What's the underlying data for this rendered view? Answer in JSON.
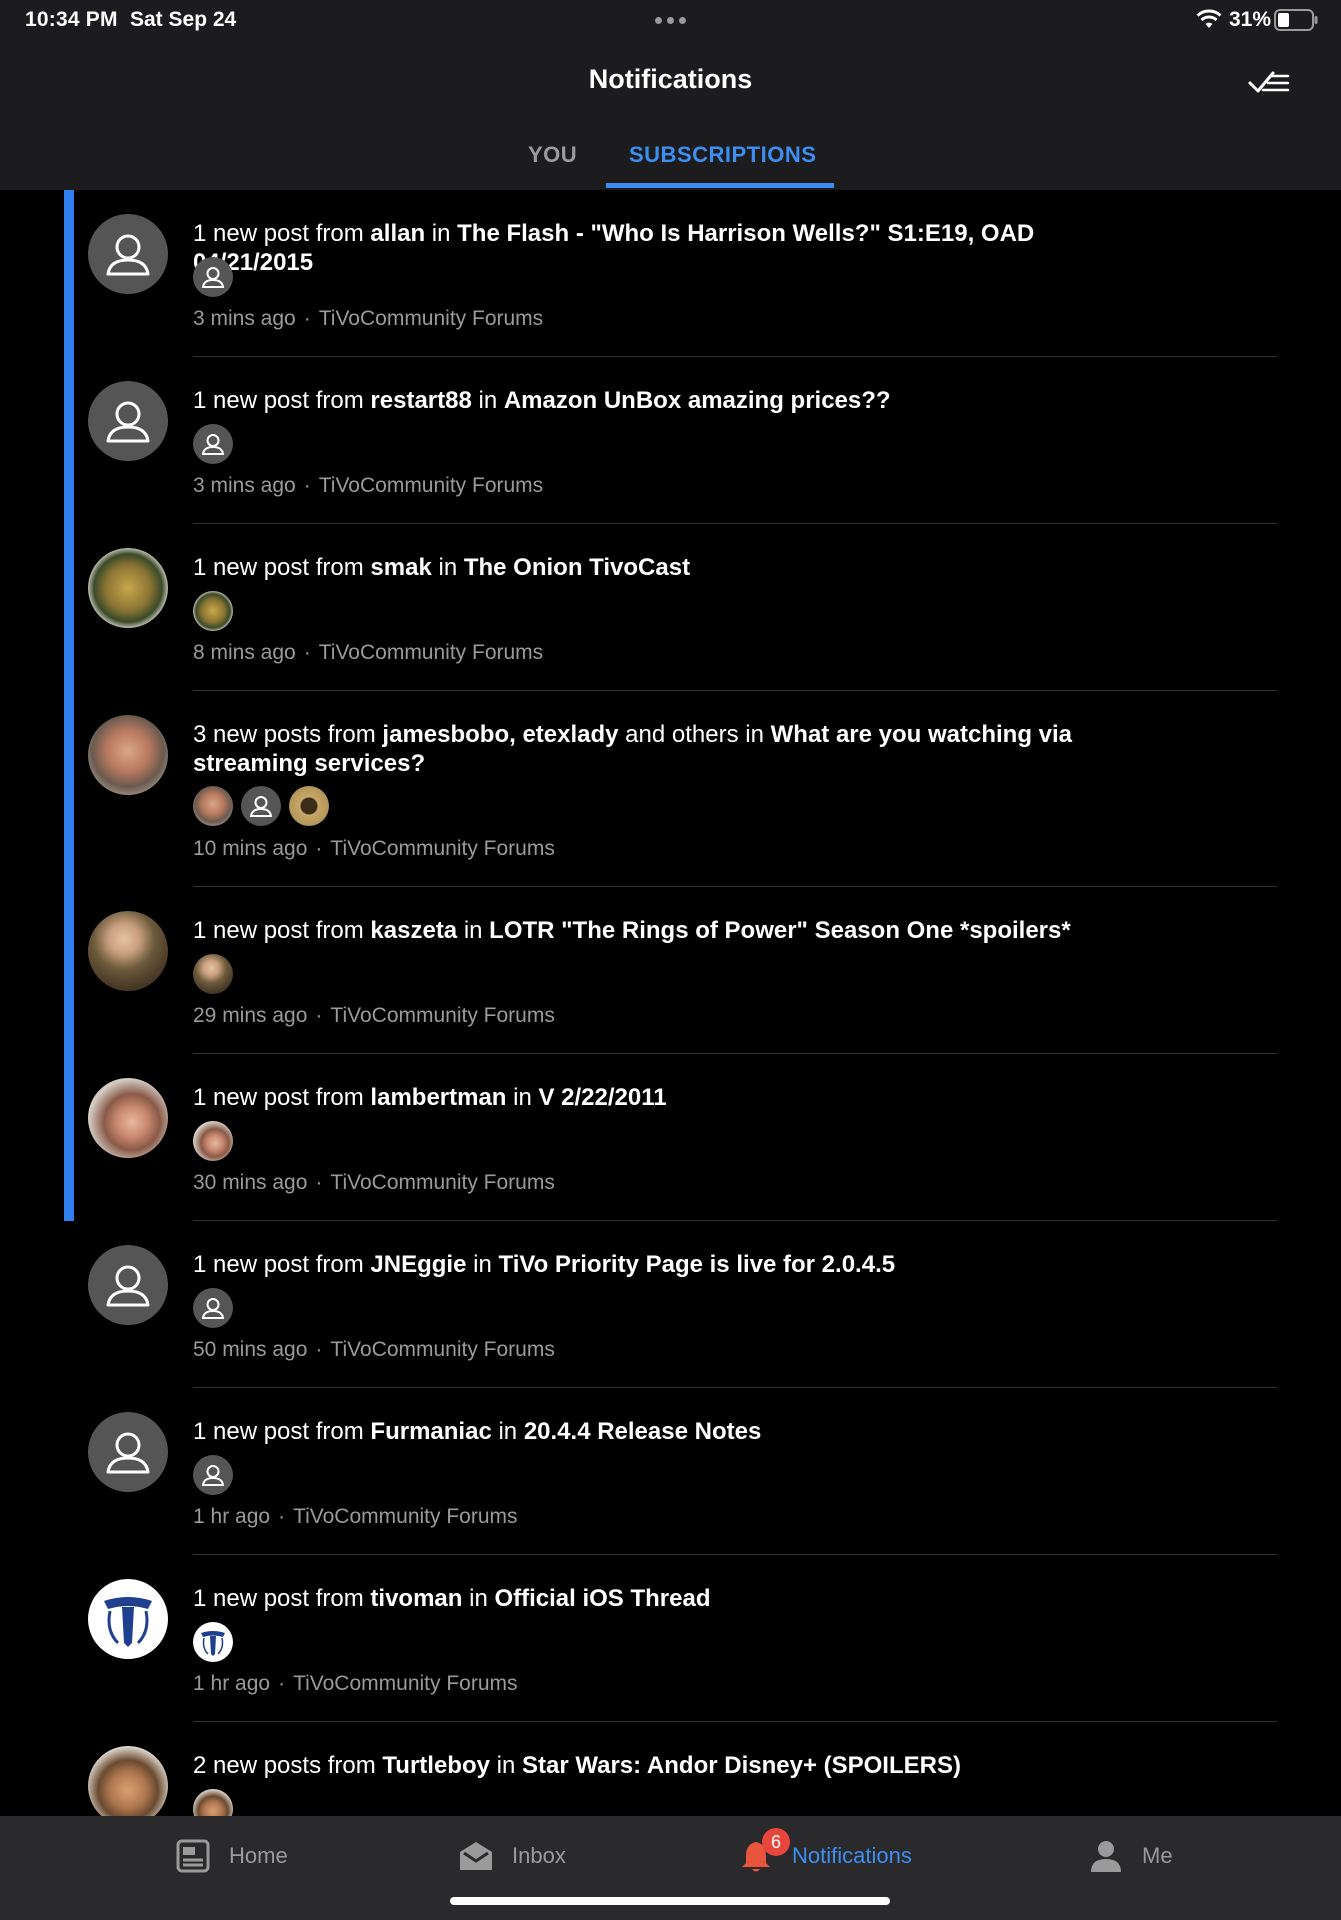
{
  "status": {
    "time": "10:34 PM",
    "date": "Sat Sep 24",
    "battery": "31%"
  },
  "header": {
    "title": "Notifications",
    "tabs": [
      {
        "label": "YOU"
      },
      {
        "label": "SUBSCRIPTIONS"
      }
    ]
  },
  "items": [
    {
      "prefix": "1 new post from ",
      "users": "allan",
      "mid": " in ",
      "thread": "The Flash - \"Who Is Harrison Wells?\" S1:E19, OAD 04/21/2015",
      "time": "3 mins ago",
      "source": "TiVoCommunity Forums",
      "avatar": "default-avatar-icon"
    },
    {
      "prefix": "1 new post from ",
      "users": "restart88",
      "mid": " in ",
      "thread": "Amazon UnBox amazing prices??",
      "time": "3 mins ago",
      "source": "TiVoCommunity Forums",
      "avatar": "default-avatar-icon"
    },
    {
      "prefix": "1 new post from ",
      "users": "smak",
      "mid": " in ",
      "thread": "The Onion TivoCast",
      "time": "8 mins ago",
      "source": "TiVoCommunity Forums",
      "avatar": "food-photo"
    },
    {
      "prefix": "3 new posts from ",
      "users": "jamesbobo, etexlady",
      "mid": " and others in ",
      "thread": "What are you watching via streaming services?",
      "time": "10 mins ago",
      "source": "TiVoCommunity Forums",
      "avatar": "person-photo"
    },
    {
      "prefix": "1 new post from ",
      "users": "kaszeta",
      "mid": " in ",
      "thread": "LOTR \"The Rings of Power\" Season One *spoilers*",
      "time": "29 mins ago",
      "source": "TiVoCommunity Forums",
      "avatar": "person-photo"
    },
    {
      "prefix": "1 new post from ",
      "users": "lambertman",
      "mid": " in ",
      "thread": "V 2/22/2011",
      "time": "30 mins ago",
      "source": "TiVoCommunity Forums",
      "avatar": "person-photo"
    },
    {
      "prefix": "1 new post from ",
      "users": "JNEggie",
      "mid": " in ",
      "thread": "TiVo Priority Page is live for 2.0.4.5",
      "time": "50 mins ago",
      "source": "TiVoCommunity Forums",
      "avatar": "default-avatar-icon"
    },
    {
      "prefix": "1 new post from ",
      "users": "Furmaniac",
      "mid": " in ",
      "thread": "20.4.4 Release Notes",
      "time": "1 hr ago",
      "source": "TiVoCommunity Forums",
      "avatar": "default-avatar-icon"
    },
    {
      "prefix": "1 new post from ",
      "users": "tivoman",
      "mid": " in ",
      "thread": "Official iOS Thread",
      "time": "1 hr ago",
      "source": "TiVoCommunity Forums",
      "avatar": "tivo-logo"
    },
    {
      "prefix": "2 new posts from ",
      "users": "Turtleboy",
      "mid": " in ",
      "thread": "Star Wars: Andor  Disney+ (SPOILERS)",
      "time": "",
      "source": "",
      "avatar": "person-photo"
    }
  ],
  "tabbar": {
    "items": [
      {
        "label": "Home"
      },
      {
        "label": "Inbox"
      },
      {
        "label": "Notifications",
        "badge": "6"
      },
      {
        "label": "Me"
      }
    ]
  },
  "colors": {
    "accent": "#3d8ef0",
    "unread_bar": "#2f7fec",
    "badge": "#e8453c"
  }
}
